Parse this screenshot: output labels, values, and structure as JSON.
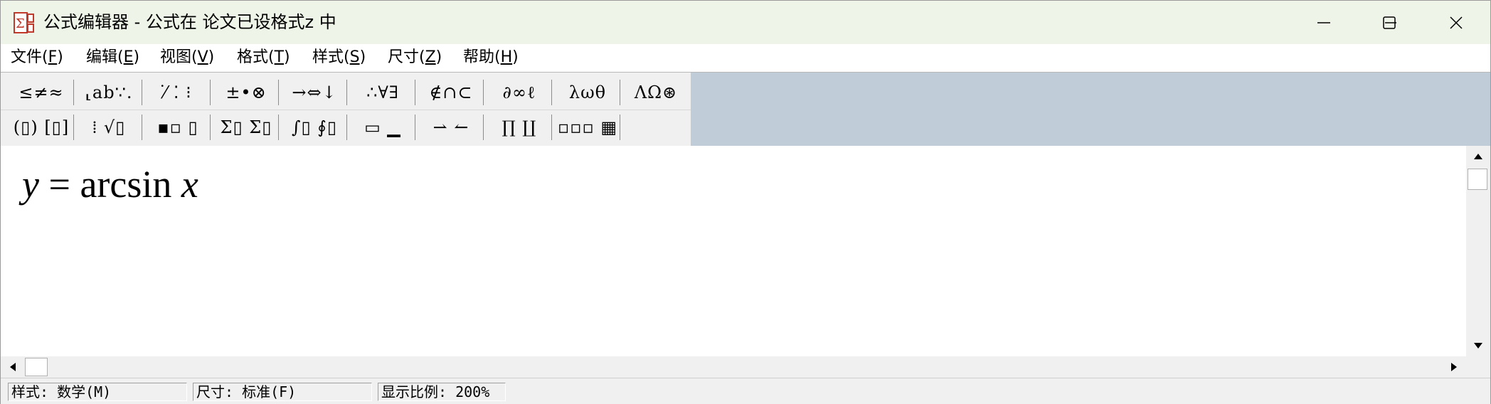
{
  "window": {
    "title": "公式编辑器 - 公式在 论文已设格式z 中",
    "icon": "sigma-app-icon"
  },
  "menu": [
    {
      "label": "文件(",
      "key": "F",
      "end": ")"
    },
    {
      "label": "编辑(",
      "key": "E",
      "end": ")"
    },
    {
      "label": "视图(",
      "key": "V",
      "end": ")"
    },
    {
      "label": "格式(",
      "key": "T",
      "end": ")"
    },
    {
      "label": "样式(",
      "key": "S",
      "end": ")"
    },
    {
      "label": "尺寸(",
      "key": "Z",
      "end": ")"
    },
    {
      "label": "帮助(",
      "key": "H",
      "end": ")"
    }
  ],
  "toolbar": {
    "row1": [
      {
        "name": "relations-palette",
        "glyph": "≤≠≈"
      },
      {
        "name": "spaces-ellipses-palette",
        "glyph": "⸤ab∵."
      },
      {
        "name": "embellishments-palette",
        "glyph": "⁄̇ ⁚ ⁝"
      },
      {
        "name": "operators-palette",
        "glyph": "±•⊗"
      },
      {
        "name": "arrows-palette",
        "glyph": "→⇔↓"
      },
      {
        "name": "logic-palette",
        "glyph": "∴∀∃"
      },
      {
        "name": "set-theory-palette",
        "glyph": "∉∩⊂"
      },
      {
        "name": "misc-symbols-palette",
        "glyph": "∂∞ℓ"
      },
      {
        "name": "greek-lower-palette",
        "glyph": "λωθ"
      },
      {
        "name": "greek-upper-palette",
        "glyph": "ΛΩ⊛"
      }
    ],
    "row2": [
      {
        "name": "fences-templates",
        "glyph": "(▯) [▯]"
      },
      {
        "name": "fractions-radicals-templates",
        "glyph": "⁞ √▯"
      },
      {
        "name": "scripts-templates",
        "glyph": "▪▫ ▯"
      },
      {
        "name": "summation-templates",
        "glyph": "Σ▯ Σ▯"
      },
      {
        "name": "integral-templates",
        "glyph": "∫▯ ∮▯"
      },
      {
        "name": "bars-templates",
        "glyph": "▭ ▁"
      },
      {
        "name": "labeled-arrows-templates",
        "glyph": "⇀ ↼"
      },
      {
        "name": "products-templates",
        "glyph": "∏ ∐"
      },
      {
        "name": "matrix-templates",
        "glyph": "▫▫▫ ▦"
      }
    ]
  },
  "editor": {
    "formula": {
      "var": "y",
      "eq": " = ",
      "func": "arcsin ",
      "arg": "x"
    }
  },
  "status": {
    "style": "样式: 数学(M)",
    "size": "尺寸: 标准(F)",
    "zoom": "显示比例: 200%"
  },
  "colors": {
    "titlebar": "#eef5e8",
    "toolbar_bg": "#c0ccd8"
  }
}
